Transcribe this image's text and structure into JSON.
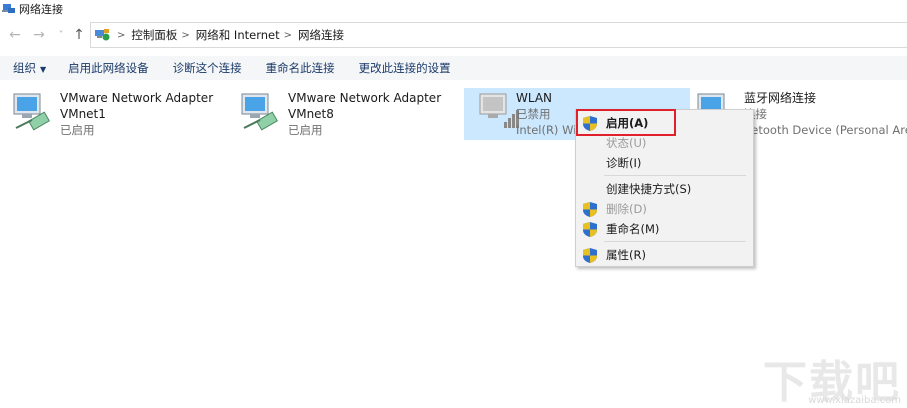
{
  "window": {
    "title": "网络连接"
  },
  "nav": {
    "back": "←",
    "forward": "→",
    "recent": "˅",
    "up": "↑"
  },
  "breadcrumb": [
    "控制面板",
    "网络和 Internet",
    "网络连接"
  ],
  "commands": [
    {
      "label": "组织",
      "has_caret": true
    },
    {
      "label": "启用此网络设备"
    },
    {
      "label": "诊断这个连接"
    },
    {
      "label": "重命名此连接"
    },
    {
      "label": "更改此连接的设置"
    }
  ],
  "connections": [
    {
      "name": "VMware Network Adapter",
      "name2": "VMnet1",
      "status": "已启用",
      "device": ""
    },
    {
      "name": "VMware Network Adapter",
      "name2": "VMnet8",
      "status": "已启用",
      "device": ""
    },
    {
      "name": "WLAN",
      "status": "已禁用",
      "device": "Intel(R) Wi-",
      "selected": true
    },
    {
      "name": "蓝牙网络连接",
      "status": "连接",
      "device": "uetooth Device (Personal Are..."
    }
  ],
  "context_menu": [
    {
      "label": "启用(A)",
      "shield": true,
      "bold": true
    },
    {
      "label": "状态(U)",
      "disabled": true
    },
    {
      "label": "诊断(I)"
    },
    {
      "label": "创建快捷方式(S)"
    },
    {
      "label": "删除(D)",
      "shield": true,
      "disabled": true
    },
    {
      "label": "重命名(M)",
      "shield": true
    },
    {
      "label": "属性(R)",
      "shield": true
    }
  ],
  "watermark": {
    "text": "下载吧",
    "url": "www.xiazaiba.com"
  },
  "colors": {
    "selection": "#cce8ff",
    "highlight_border": "#e0202a",
    "link": "#1a3a6a"
  }
}
